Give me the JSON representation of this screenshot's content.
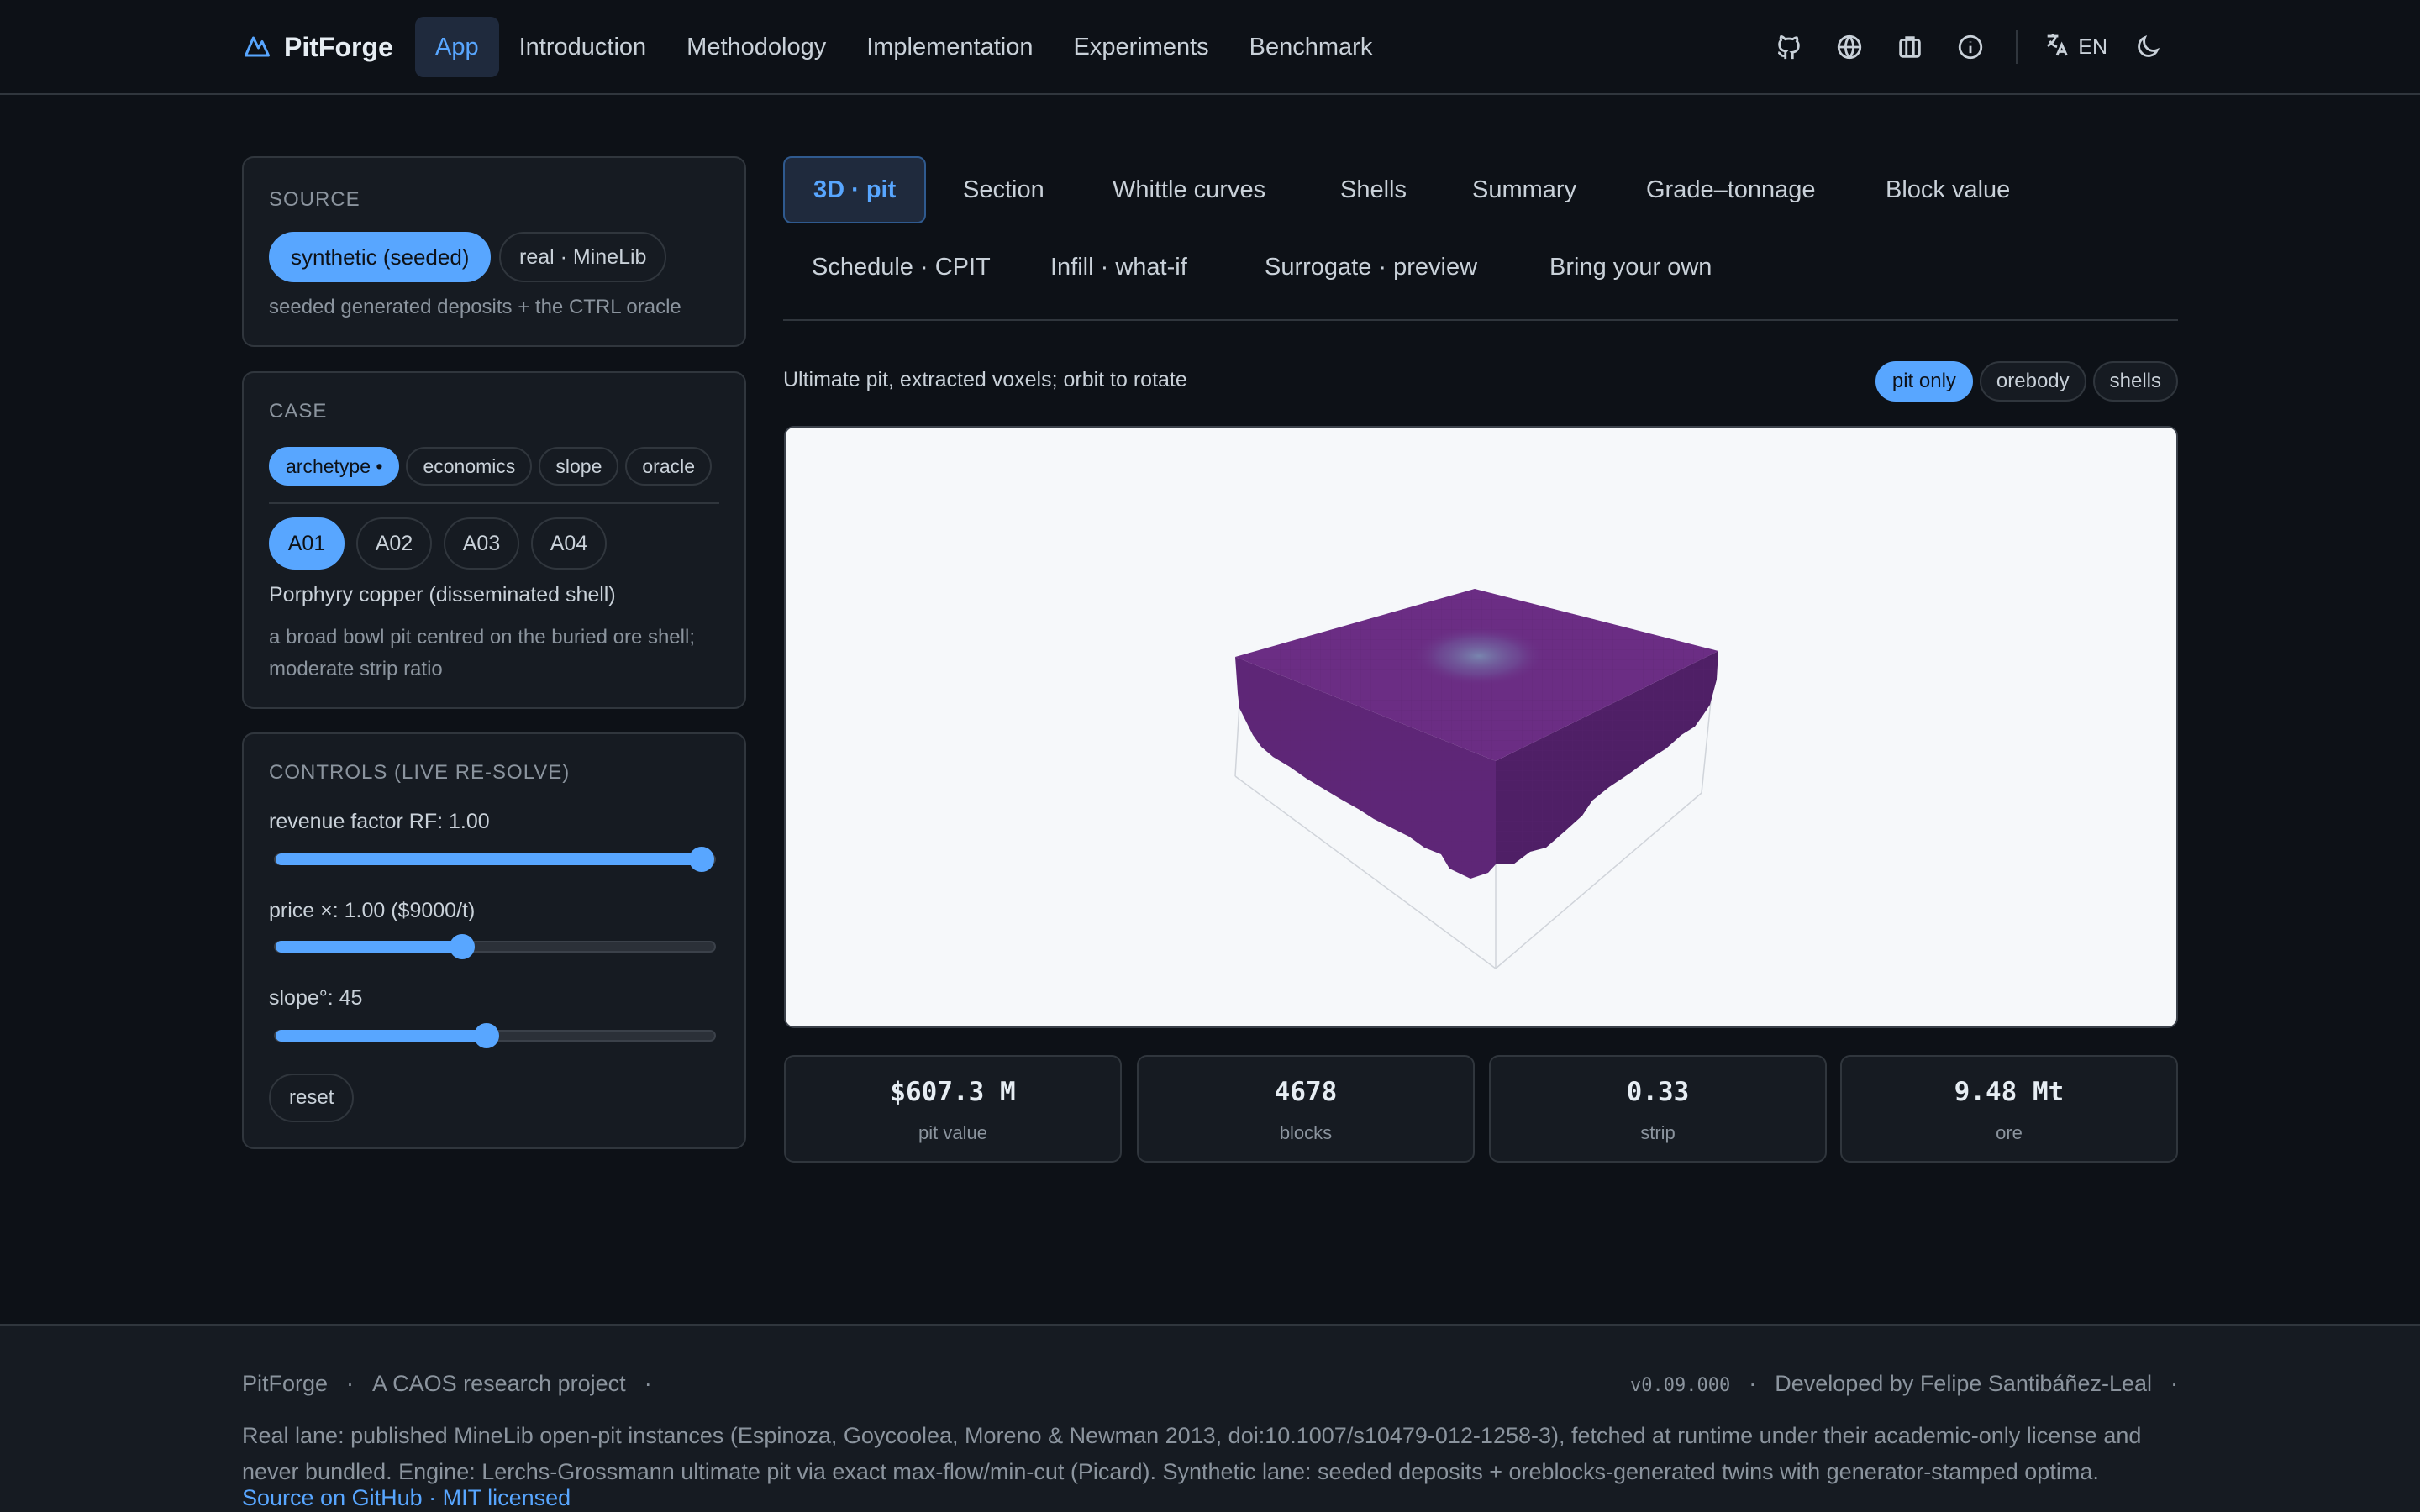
{
  "brand": {
    "name": "PitForge"
  },
  "nav": {
    "items": [
      "App",
      "Introduction",
      "Methodology",
      "Implementation",
      "Experiments",
      "Benchmark"
    ],
    "active": "App"
  },
  "header_icons": [
    "github-icon",
    "globe-icon",
    "briefcase-icon",
    "info-icon",
    "translate-icon",
    "moon-icon"
  ],
  "language": {
    "label": "EN"
  },
  "source": {
    "title": "SOURCE",
    "options": [
      "synthetic (seeded)",
      "real · MineLib"
    ],
    "selected": "synthetic (seeded)",
    "description": "seeded generated deposits + the CTRL oracle"
  },
  "case": {
    "title": "CASE",
    "filters": [
      "archetype •",
      "economics",
      "slope",
      "oracle"
    ],
    "selected_filter": "archetype •",
    "ids": [
      "A01",
      "A02",
      "A03",
      "A04"
    ],
    "selected_id": "A01",
    "name": "Porphyry copper (disseminated shell)",
    "description": "a broad bowl pit centred on the buried ore shell; moderate strip ratio"
  },
  "controls": {
    "title": "CONTROLS (LIVE RE-SOLVE)",
    "revenue_label": "revenue factor RF: 1.00",
    "revenue_fraction": 1.0,
    "price_label": "price ×: 1.00 ($9000/t)",
    "price_fraction": 0.42,
    "slope_label": "slope°: 45",
    "slope_fraction": 0.48,
    "reset_label": "reset"
  },
  "tabs": {
    "row1": [
      "3D · pit",
      "Section",
      "Whittle curves",
      "Shells",
      "Summary",
      "Grade–tonnage",
      "Block value"
    ],
    "row2": [
      "Schedule · CPIT",
      "Infill · what-if",
      "Surrogate · preview",
      "Bring your own"
    ],
    "active": "3D · pit"
  },
  "view": {
    "caption": "Ultimate pit, extracted voxels; orbit to rotate",
    "toggles": [
      "pit only",
      "orebody",
      "shells"
    ],
    "selected_toggle": "pit only",
    "pit_color": "#6b2d84"
  },
  "stats": [
    {
      "value": "$607.3 M",
      "label": "pit value"
    },
    {
      "value": "4678",
      "label": "blocks"
    },
    {
      "value": "0.33",
      "label": "strip"
    },
    {
      "value": "9.48 Mt",
      "label": "ore"
    }
  ],
  "footer": {
    "brand": "PitForge",
    "project": "A CAOS research project",
    "sep": "·",
    "version": "v0.09.000",
    "developer": "Developed by Felipe Santibáñez-Leal",
    "text": "Real lane: published MineLib open-pit instances (Espinoza, Goycoolea, Moreno & Newman 2013, doi:10.1007/s10479-012-1258-3), fetched at runtime under their academic-only license and never bundled. Engine: Lerchs-Grossmann ultimate pit via exact max-flow/min-cut (Picard). Synthetic lane: seeded deposits + oreblocks-generated twins with generator-stamped optima.",
    "link": "Source on GitHub · MIT licensed"
  },
  "colors": {
    "accent": "#58a6ff",
    "background": "#0d1117",
    "panel": "#161b22",
    "pit": "#6b2d84"
  }
}
